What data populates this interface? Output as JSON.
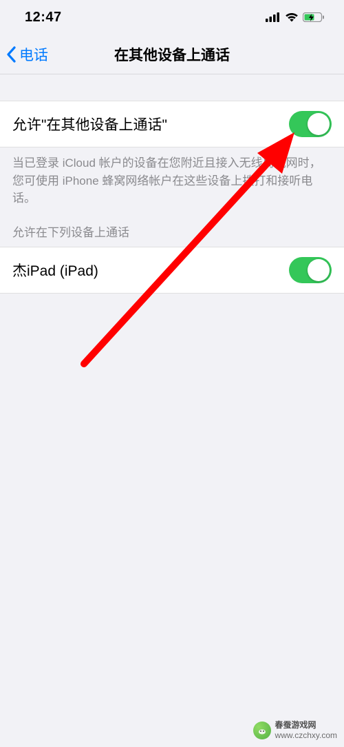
{
  "status": {
    "time": "12:47"
  },
  "nav": {
    "back_label": "电话",
    "title": "在其他设备上通话"
  },
  "main_toggle": {
    "label": "允许\"在其他设备上通话\"",
    "on": true
  },
  "footer_text": "当已登录 iCloud 帐户的设备在您附近且接入无线局域网时，您可使用 iPhone 蜂窝网络帐户在这些设备上拨打和接听电话。",
  "devices_header": "允许在下列设备上通话",
  "devices": [
    {
      "label": "杰iPad (iPad)",
      "on": true
    }
  ],
  "watermark": {
    "line1": "春蚕游戏网",
    "line2": "www.czchxy.com"
  },
  "colors": {
    "accent": "#007aff",
    "toggle_on": "#34c759",
    "arrow": "#ff0000"
  }
}
